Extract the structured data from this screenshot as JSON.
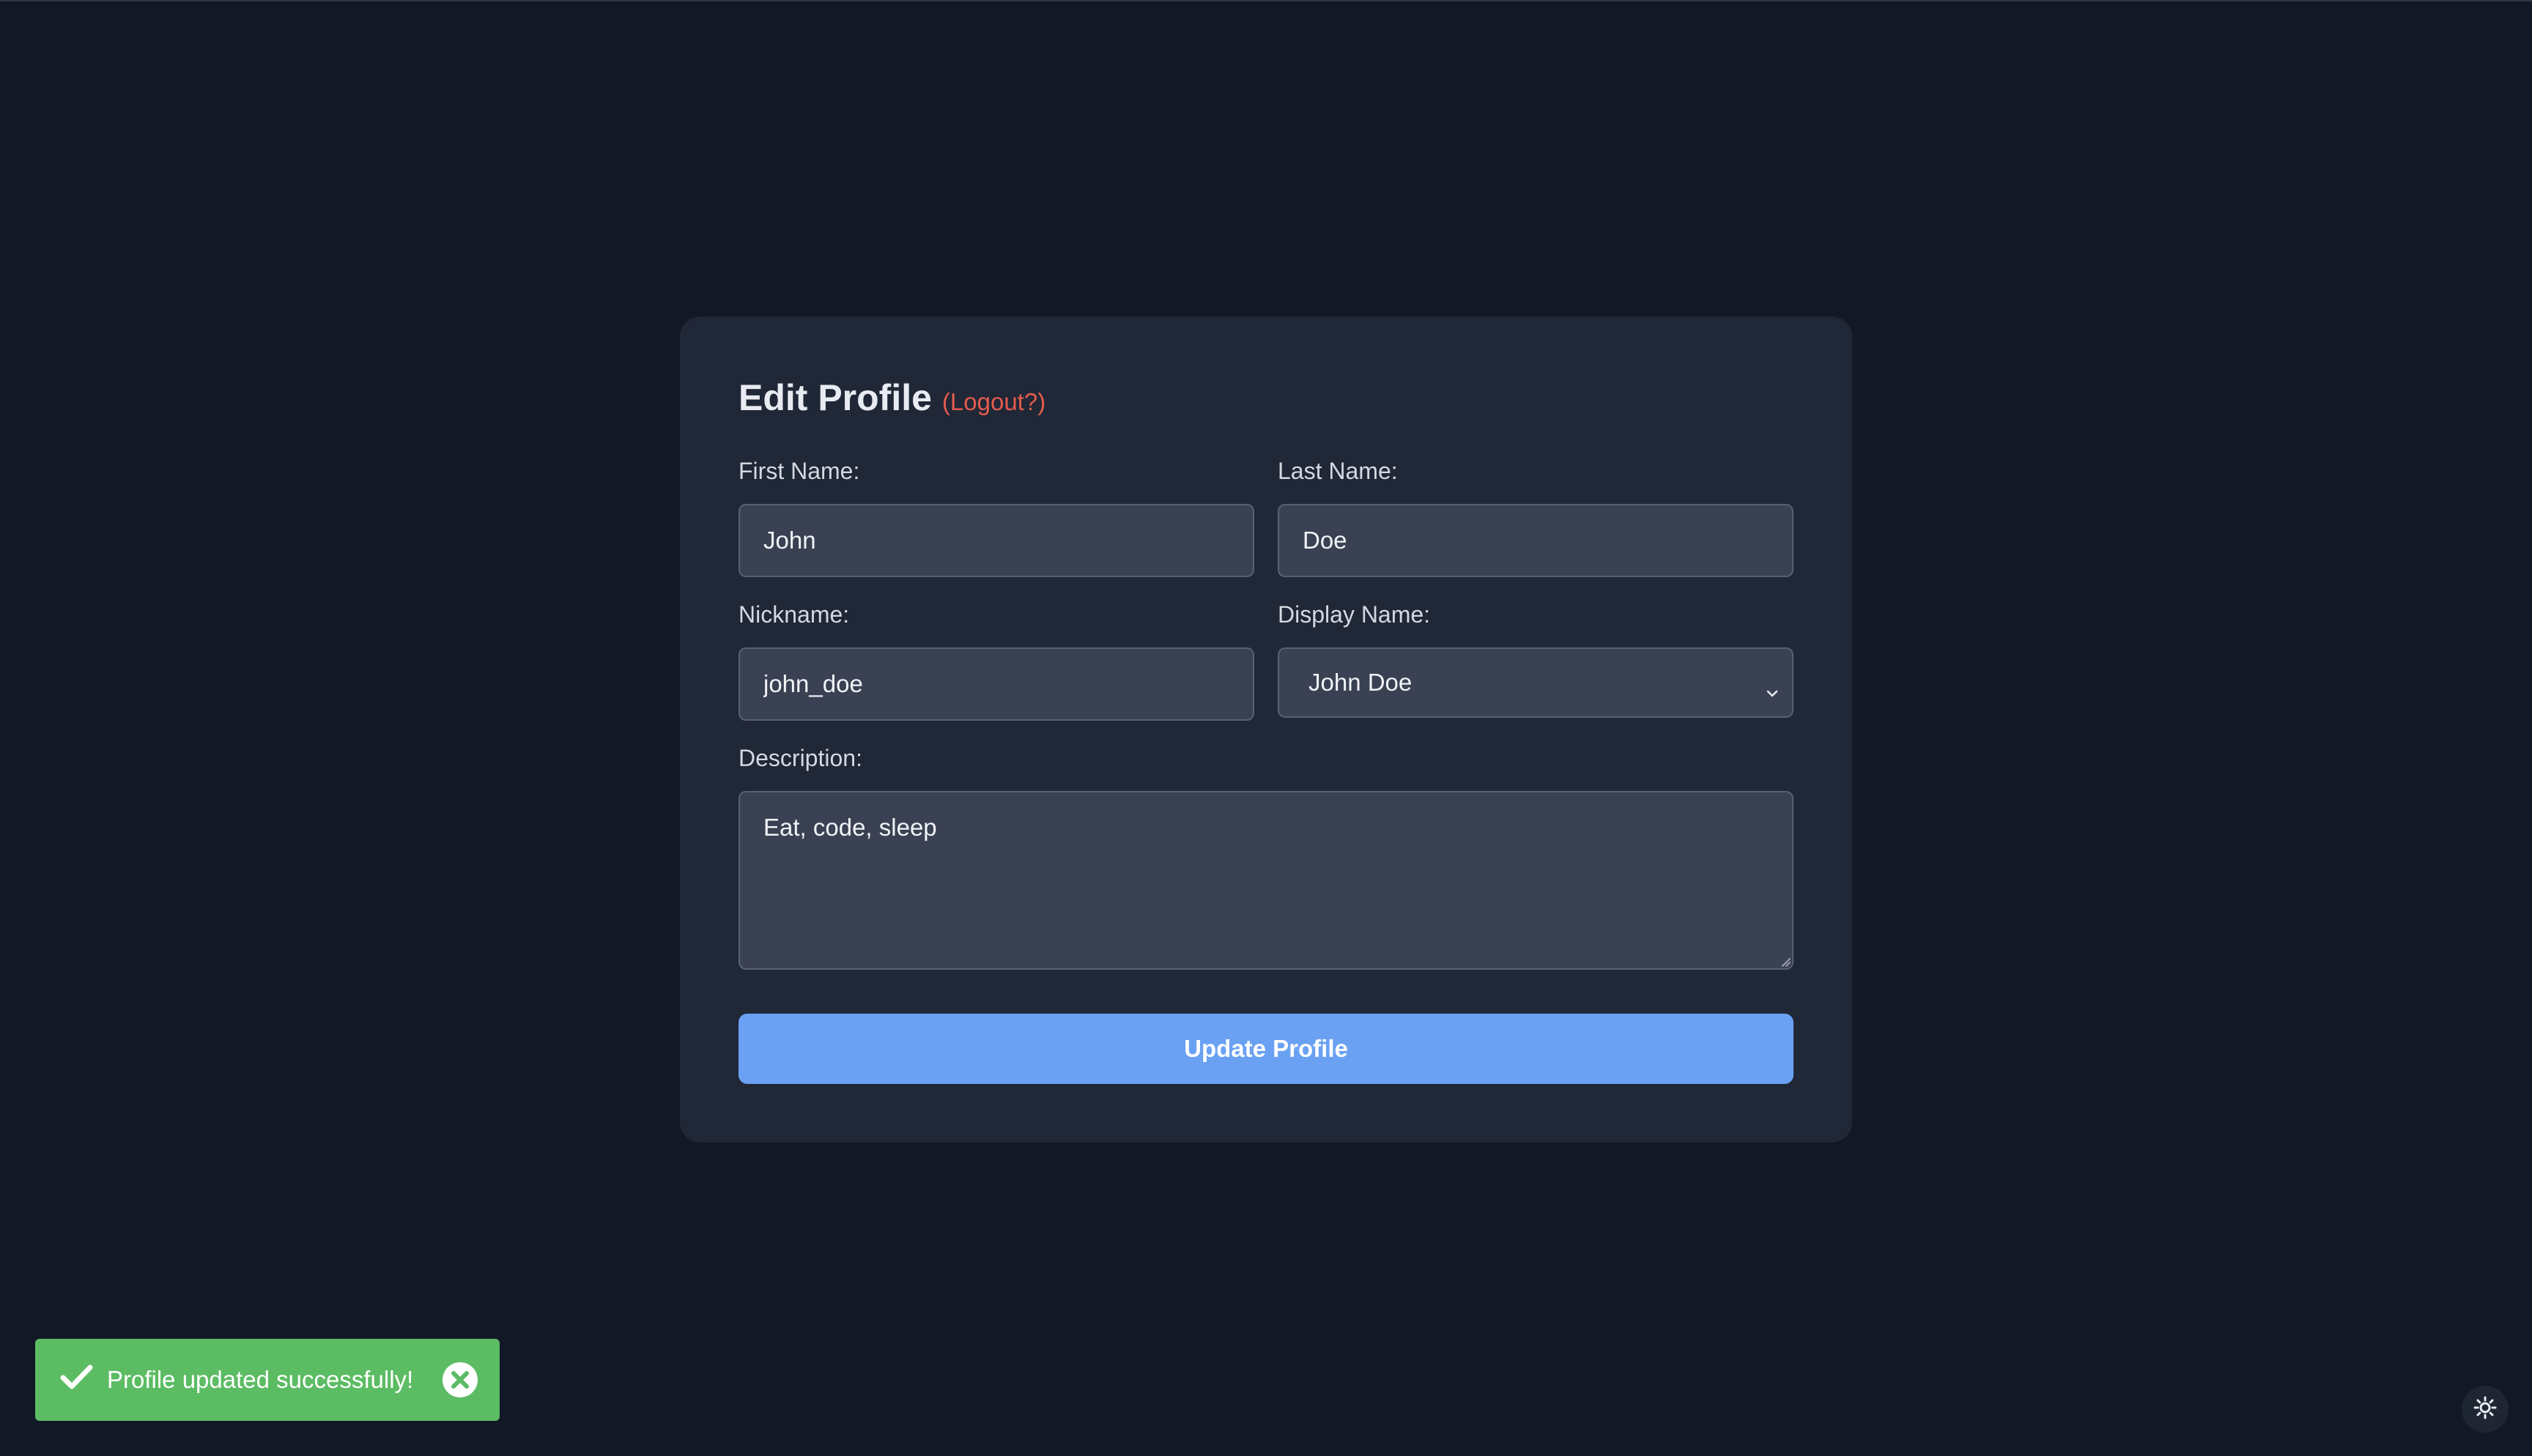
{
  "form": {
    "title": "Edit Profile",
    "logout_link": "(Logout?)",
    "first_name": {
      "label": "First Name:",
      "value": "John"
    },
    "last_name": {
      "label": "Last Name:",
      "value": "Doe"
    },
    "nickname": {
      "label": "Nickname:",
      "value": "john_doe"
    },
    "display_name": {
      "label": "Display Name:",
      "selected": "John Doe"
    },
    "description": {
      "label": "Description:",
      "value": "Eat, code, sleep"
    },
    "submit_label": "Update Profile"
  },
  "toast": {
    "message": "Profile updated successfully!",
    "icon": "check-icon",
    "close_icon": "close-circle-icon"
  },
  "theme_toggle": {
    "icon": "sun-icon"
  },
  "colors": {
    "background": "#121826",
    "card": "#202736",
    "input": "#3a4152",
    "accent": "#6aa1f3",
    "logout": "#e25c4e",
    "success": "#5cbc63"
  }
}
